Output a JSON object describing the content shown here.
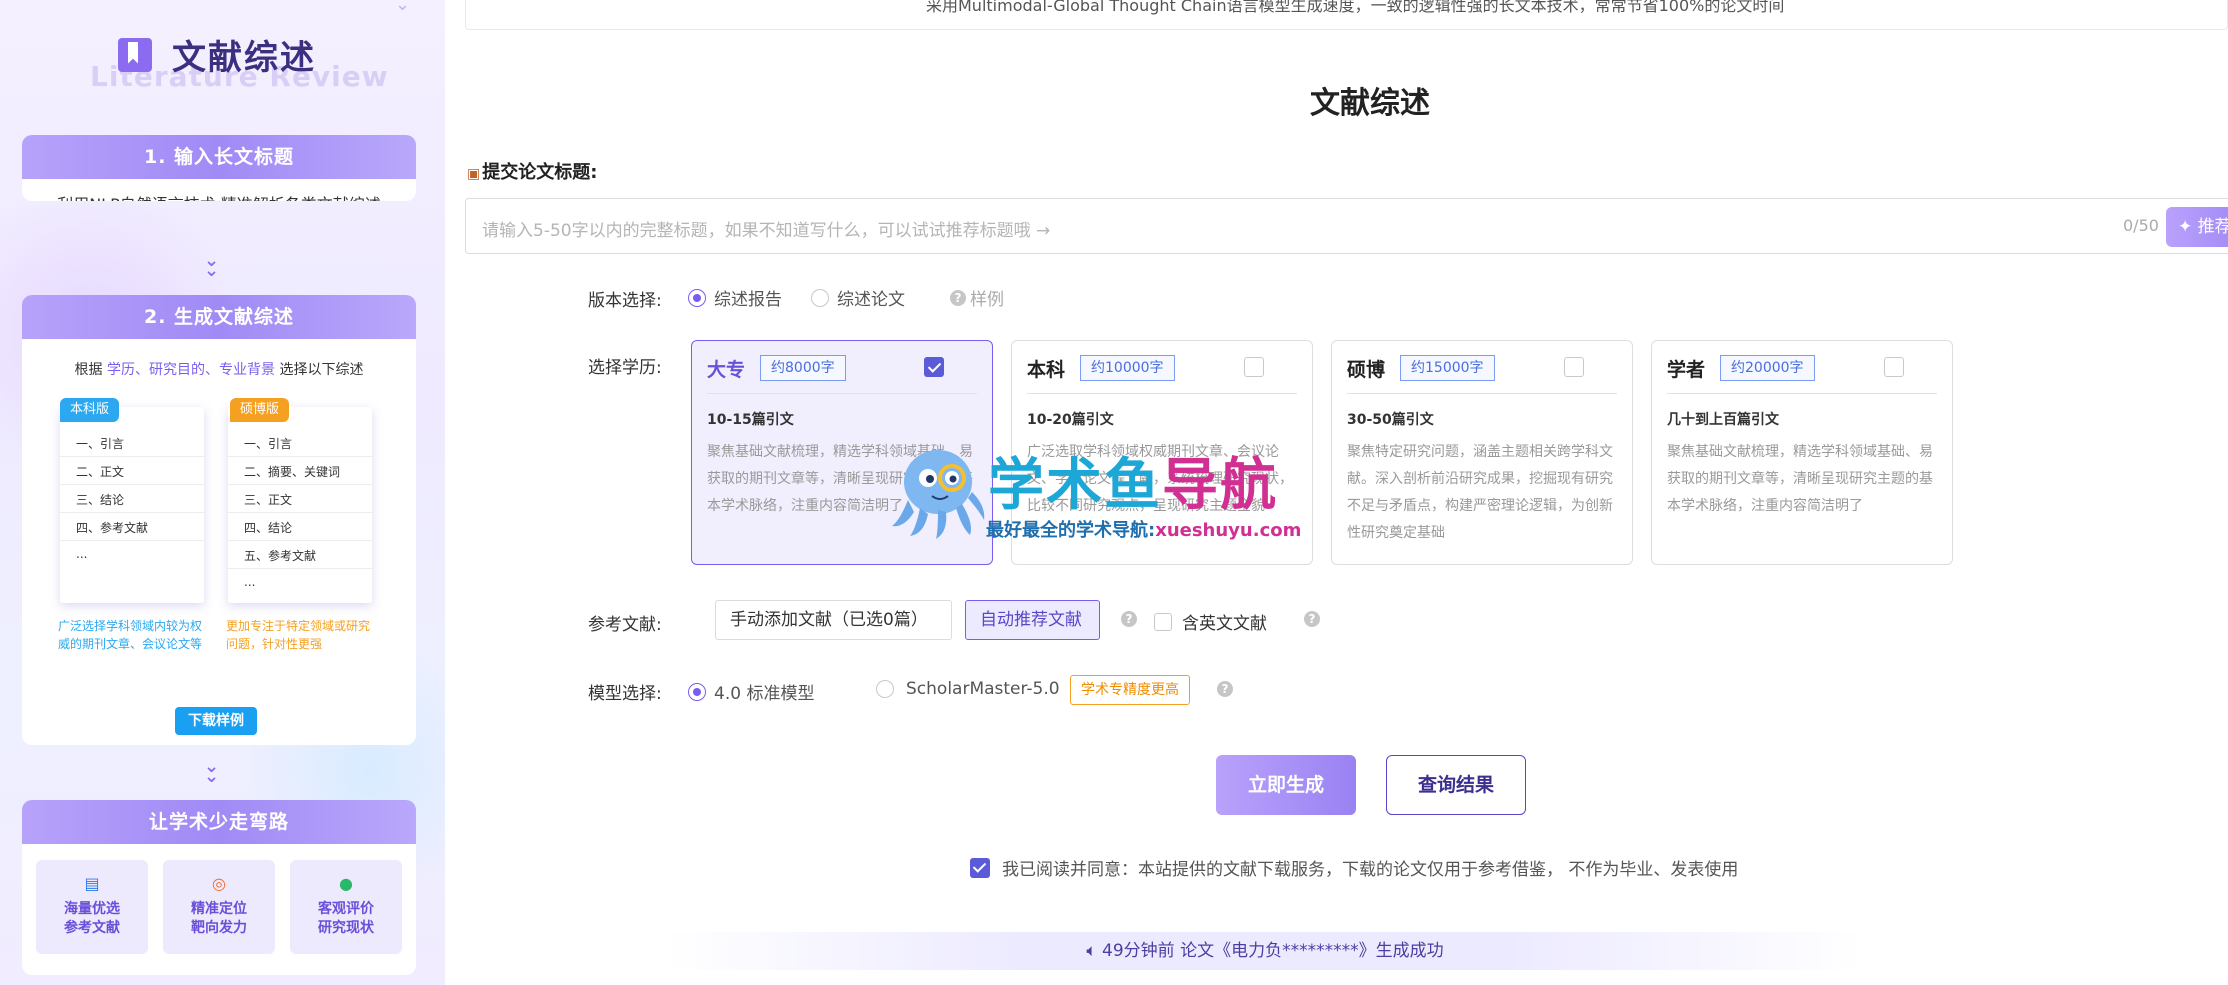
{
  "sidebar": {
    "brand_title": "文献综述",
    "brand_subtitle": "Literature Review",
    "step1": {
      "title": "1. 输入长文标题",
      "body": "利用NLP自然语言技术  精准解析各类文献综述"
    },
    "step2": {
      "title": "2. 生成文献综述",
      "intro_prefix": "根据 ",
      "intro_highlight": "学历、研究目的、专业背景",
      "intro_suffix": " 选择以下综述",
      "undergrad": {
        "tag": "本科版",
        "lines": [
          "一、引言",
          "二、正文",
          "三、结论",
          "四、参考文献",
          "..."
        ],
        "desc": "广泛选择学科领域内较为权威的期刊文章、会议论文等"
      },
      "graduate": {
        "tag": "硕博版",
        "lines": [
          "一、引言",
          "二、摘要、关键词",
          "三、正文",
          "四、结论",
          "五、参考文献",
          "..."
        ],
        "desc": "更加专注于特定领域或研究问题，针对性更强"
      },
      "download_label": "下载样例"
    },
    "step3": {
      "title": "让学术少走弯路",
      "features": [
        {
          "icon": "document-stack-icon",
          "line1": "海量优选",
          "line2": "参考文献"
        },
        {
          "icon": "target-icon",
          "line1": "精准定位",
          "line2": "靶向发力"
        },
        {
          "icon": "chat-bubble-icon",
          "line1": "客观评价",
          "line2": "研究现状"
        }
      ]
    }
  },
  "main": {
    "top_notice": "采用Multimodal-Global Thought Chain语言模型生成速度，一致的逻辑性强的长文本技术，常常节省100%的论文时间",
    "page_title": "文献综述",
    "submit_label": "提交论文标题:",
    "title_input": {
      "placeholder": "请输入5-50字以内的完整标题，如果不知道写什么，可以试试推荐标题哦 →",
      "counter": "0/50"
    },
    "recommend_label": "推荐标题",
    "version": {
      "label": "版本选择:",
      "options": [
        "综述报告",
        "综述论文"
      ],
      "selected": 0,
      "sample": "样例"
    },
    "education": {
      "label": "选择学历:",
      "cards": [
        {
          "name": "大专",
          "words": "约8000字",
          "citations": "10-15篇引文",
          "desc": "聚焦基础文献梳理，精选学科领域基础、易获取的期刊文章等，清晰呈现研究主题的基本学术脉络，注重内容简洁明了",
          "checked": true
        },
        {
          "name": "本科",
          "words": "约10000字",
          "citations": "10-20篇引文",
          "desc": "广泛选取学科领域权威期刊文章、会议论文、学位论文等文献，系统梳理研究现状，比较不同研究观点，呈现研究主题全貌",
          "checked": false
        },
        {
          "name": "硕博",
          "words": "约15000字",
          "citations": "30-50篇引文",
          "desc": "聚焦特定研究问题，涵盖主题相关跨学科文献。深入剖析前沿研究成果，挖掘现有研究不足与矛盾点，构建严密理论逻辑，为创新性研究奠定基础",
          "checked": false
        },
        {
          "name": "学者",
          "words": "约20000字",
          "citations": "几十到上百篇引文",
          "desc": "聚焦基础文献梳理，精选学科领域基础、易获取的期刊文章等，清晰呈现研究主题的基本学术脉络，注重内容简洁明了",
          "checked": false
        }
      ]
    },
    "references": {
      "label": "参考文献:",
      "manual": "手动添加文献（已选0篇）",
      "auto": "自动推荐文献",
      "english": "含英文文献"
    },
    "model": {
      "label": "模型选择:",
      "options": [
        "4.0 标准模型",
        "ScholarMaster-5.0"
      ],
      "selected": 0,
      "badge": "学术专精度更高"
    },
    "generate_label": "立即生成",
    "query_label": "查询结果",
    "agreement": "我已阅读并同意：本站提供的文献下载服务，下载的论文仅用于参考借鉴， 不作为毕业、发表使用",
    "ticker": "49分钟前 论文《电力负*********》生成成功"
  },
  "watermark": {
    "title_a": "学术鱼",
    "title_b": "导航",
    "sub_a": "最好最全的学术导航:",
    "sub_b": "xueshuyu.com"
  },
  "colors": {
    "accent": "#7b5cf0",
    "sidebar_bg": "#f1ecff",
    "badge_orange": "#f5a020"
  }
}
